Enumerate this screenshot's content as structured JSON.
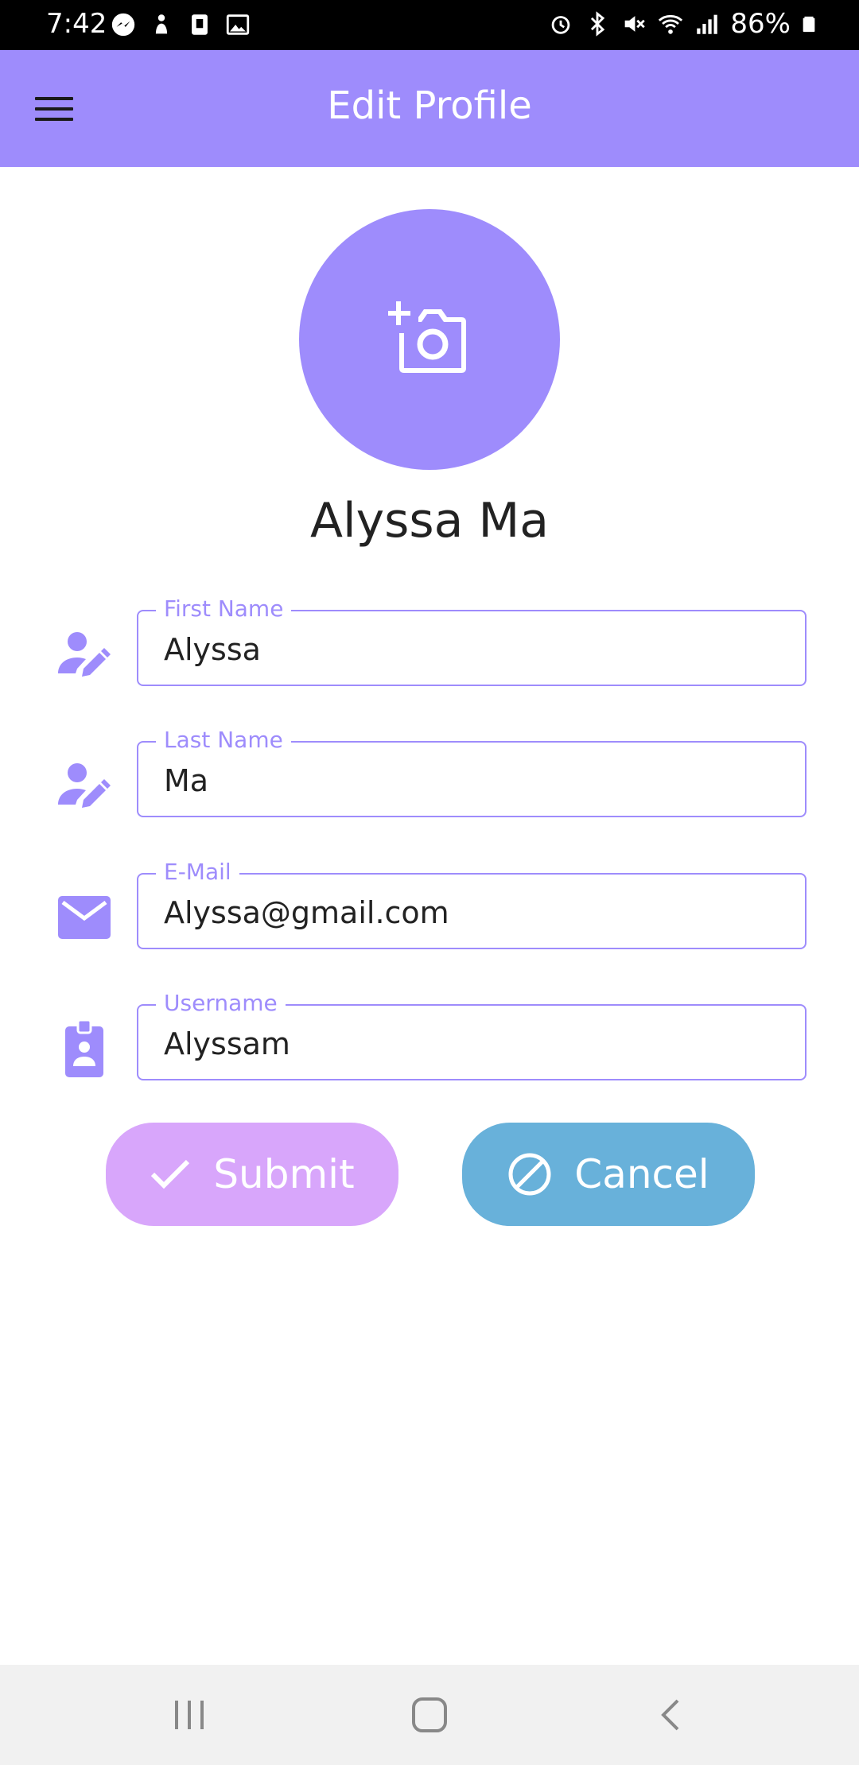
{
  "status_bar": {
    "time": "7:42",
    "battery": "86%",
    "left_icons": [
      "messenger-icon",
      "notification-icon",
      "clipboard-icon",
      "gallery-icon"
    ],
    "right_icons": [
      "alarm-icon",
      "bluetooth-icon",
      "mute-icon",
      "wifi-icon",
      "signal-icon",
      "battery-icon"
    ]
  },
  "app_bar": {
    "title": "Edit Profile",
    "menu_icon": "menu-icon"
  },
  "profile": {
    "avatar_icon": "add-photo-icon",
    "name": "Alyssa Ma"
  },
  "form": {
    "fields": [
      {
        "label": "First Name",
        "value": "Alyssa",
        "icon": "person-edit-icon"
      },
      {
        "label": "Last Name",
        "value": "Ma",
        "icon": "person-edit-icon"
      },
      {
        "label": "E-Mail",
        "value": "Alyssa@gmail.com",
        "icon": "mail-icon"
      },
      {
        "label": "Username",
        "value": "Alyssam",
        "icon": "badge-icon"
      }
    ]
  },
  "actions": {
    "submit_label": "Submit",
    "cancel_label": "Cancel"
  },
  "nav_bar": {
    "buttons": [
      "recent-apps-icon",
      "home-icon",
      "back-icon"
    ]
  },
  "colors": {
    "primary": "#9e8cfc",
    "submit": "#d8a6fb",
    "cancel": "#68b1da"
  }
}
